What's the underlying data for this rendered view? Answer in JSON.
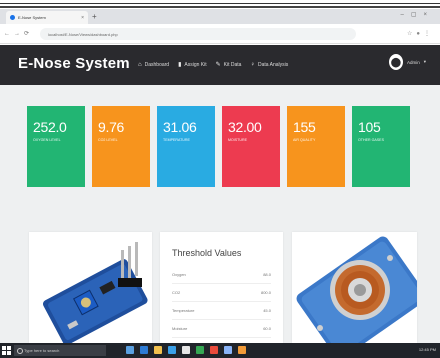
{
  "browser": {
    "tab_title": "E-Nose System",
    "url": "localhost/E-Nose/Views/dashboard.php"
  },
  "app": {
    "brand": "E-Nose System",
    "menu": [
      {
        "label": "Dashboard",
        "icon": "home-icon"
      },
      {
        "label": "Assign Kit",
        "icon": "bookmark-icon"
      },
      {
        "label": "Kit Data",
        "icon": "pin-icon"
      },
      {
        "label": "Data Analysis",
        "icon": "lightbulb-icon"
      }
    ],
    "user": "Admin"
  },
  "cards": [
    {
      "value": "252.0",
      "label": "OXYGEN LEVEL",
      "color": "#22b573"
    },
    {
      "value": "9.76",
      "label": "CO2 LEVEL",
      "color": "#f7941d"
    },
    {
      "value": "31.06",
      "label": "TEMPERATURE",
      "color": "#29abe2"
    },
    {
      "value": "32.00",
      "label": "MOISTURE",
      "color": "#ed3b50"
    },
    {
      "value": "155",
      "label": "AIR QUALITY",
      "color": "#f7941d"
    },
    {
      "value": "105",
      "label": "OTHER GASES",
      "color": "#22b573"
    }
  ],
  "threshold": {
    "title": "Threshold Values",
    "rows": [
      {
        "name": "Oxygen",
        "value": "88.0"
      },
      {
        "name": "CO2",
        "value": "800.0"
      },
      {
        "name": "Temperature",
        "value": "45.0"
      },
      {
        "name": "Moisture",
        "value": "60.0"
      }
    ]
  },
  "taskbar": {
    "search_placeholder": "Type here to search",
    "tray_time": "12:45 PM"
  }
}
